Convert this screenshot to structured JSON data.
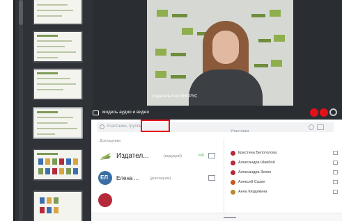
{
  "video": {
    "caption": "Издательство КНОРУС"
  },
  "toolbar": {
    "label": "модель аудио и видео"
  },
  "search": {
    "placeholder": "Участники, группы"
  },
  "columns": {
    "left_header": "Докладчики",
    "right_header": "Участники"
  },
  "hosts": [
    {
      "name": "Издател...",
      "role": "(ведущий)",
      "avatar_color": "#ffffff"
    },
    {
      "name": "Елена ...",
      "role": "(докладчик)",
      "avatar_color": "#3a6ea5",
      "initials": "ЕЛ"
    },
    {
      "name": "",
      "role": "",
      "avatar_color": "#b52a3b"
    }
  ],
  "participants": [
    {
      "name": "Кристина Белоголова"
    },
    {
      "name": "Александра Шаибой"
    },
    {
      "name": "Александра Зелик"
    },
    {
      "name": "Алексей Сазин"
    },
    {
      "name": "Анна Кирдякина"
    }
  ],
  "colors": {
    "accent_red": "#e3101b",
    "brand_green": "#8fae4e"
  }
}
